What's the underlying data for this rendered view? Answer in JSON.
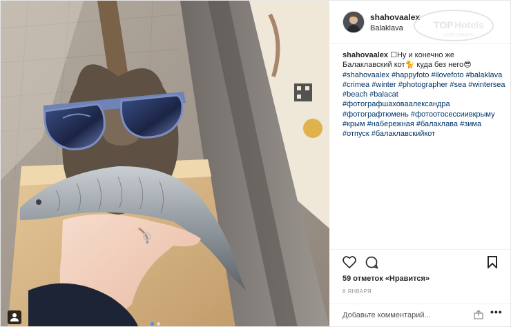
{
  "post": {
    "username": "shahovaalex",
    "location": "Balaklava",
    "watermark": {
      "brand": "TOPHotels",
      "sub": "ФОТО ТУРИСТА"
    },
    "caption": {
      "author": "shahovaalex",
      "text_segments": [
        {
          "type": "text",
          "value": " ☐Ну и конечно же Балаклавский кот"
        },
        {
          "type": "emoji",
          "value": "🐈"
        },
        {
          "type": "text",
          "value": " куда без него"
        },
        {
          "type": "emoji",
          "value": "😎"
        }
      ],
      "hashtags": [
        "#shahovaalex",
        "#happyfoto",
        "#ilovefoto",
        "#balaklava",
        "#crimea",
        "#winter",
        "#photographer",
        "#sea",
        "#wintersea",
        "#beach",
        "#balacat",
        "#фотографшаховаалександра",
        "#фотографтюмень",
        "#фотоотосессиивкрыму",
        "#крым",
        "#набережная",
        "#балаклава",
        "#зима",
        "#отпуск",
        "#балаклавскийкот"
      ]
    },
    "likes": "59 отметок «Нравится»",
    "date": "8 ЯНВАРЯ",
    "comment_placeholder": "Добавьте комментарий...",
    "more_label": "•••",
    "carousel": {
      "count": 2,
      "active": 1
    }
  },
  "colors": {
    "link": "#003569",
    "likes_text": "#262626",
    "meta_text": "#999999",
    "dot_active": "#3897f0"
  },
  "icons": {
    "photo_tag": "person-tag-icon",
    "like": "heart-icon",
    "comment": "comment-icon",
    "save": "bookmark-icon",
    "upload": "upload-icon",
    "more": "more-options-icon"
  }
}
